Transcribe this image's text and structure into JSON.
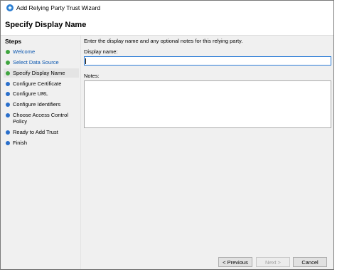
{
  "window": {
    "title": "Add Relying Party Trust Wizard",
    "heading": "Specify Display Name"
  },
  "sidebar": {
    "title": "Steps",
    "items": [
      {
        "label": "Welcome",
        "status": "done"
      },
      {
        "label": "Select Data Source",
        "status": "done"
      },
      {
        "label": "Specify Display Name",
        "status": "current"
      },
      {
        "label": "Configure Certificate",
        "status": "pending"
      },
      {
        "label": "Configure URL",
        "status": "pending"
      },
      {
        "label": "Configure Identifiers",
        "status": "pending"
      },
      {
        "label": "Choose Access Control Policy",
        "status": "pending"
      },
      {
        "label": "Ready to Add Trust",
        "status": "pending"
      },
      {
        "label": "Finish",
        "status": "pending"
      }
    ]
  },
  "main": {
    "instruction": "Enter the display name and any optional notes for this relying party.",
    "display_name_label": "Display name:",
    "display_name_value": "",
    "notes_label": "Notes:",
    "notes_value": ""
  },
  "buttons": {
    "previous": "< Previous",
    "next": "Next >",
    "cancel": "Cancel"
  },
  "colors": {
    "done_dot": "#3fa53f",
    "pending_dot": "#2a6fcb",
    "link_text": "#0b57b0",
    "focus_border": "#2a7bd6"
  },
  "icons": {
    "app": "relying-party-trust-icon",
    "step_done": "green-dot-icon",
    "step_pending": "blue-dot-icon"
  }
}
